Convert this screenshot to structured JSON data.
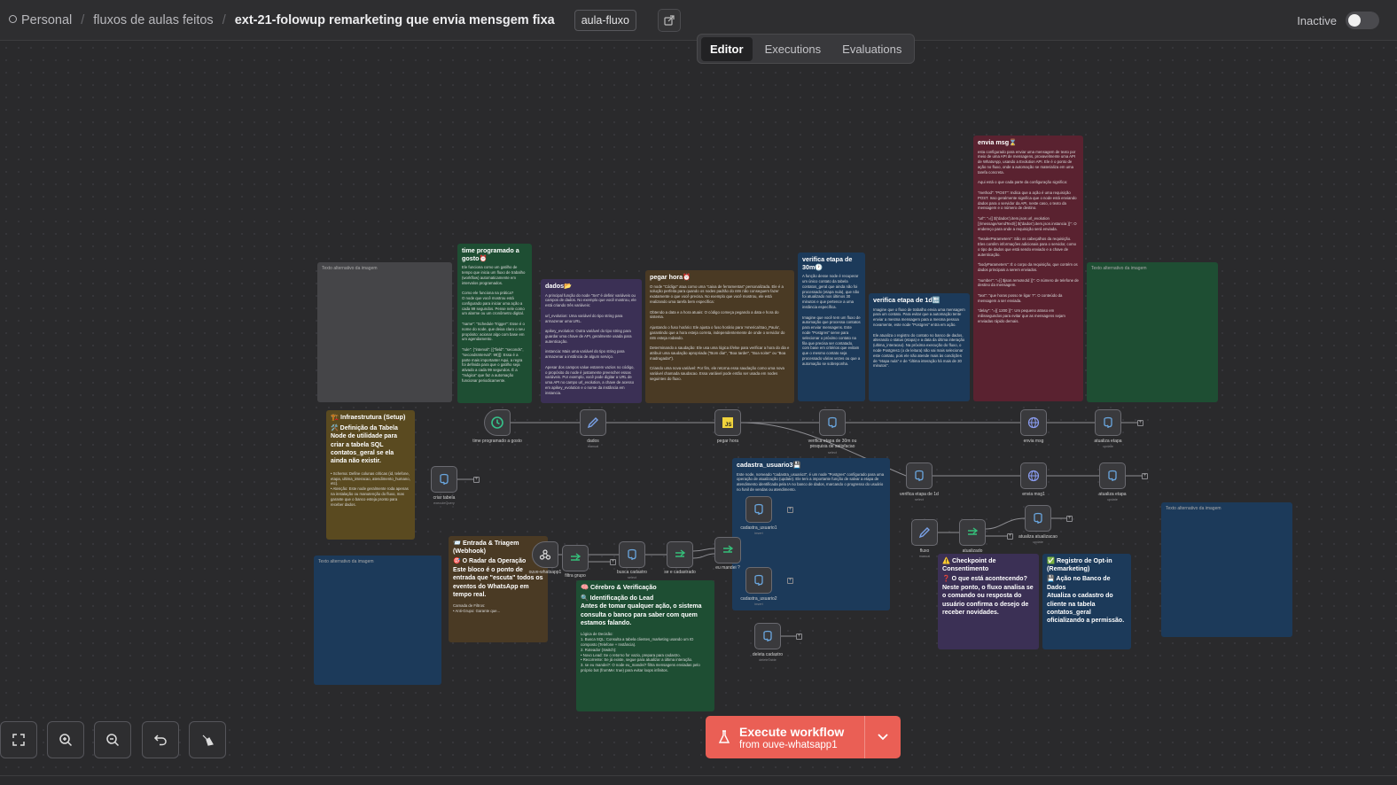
{
  "header": {
    "breadcrumb": [
      "Personal",
      "fluxos de aulas feitos",
      "ext-21-folowup remarketing que envia mensgem fixa"
    ],
    "tag": "aula-fluxo",
    "status_label": "Inactive"
  },
  "tabs": [
    "Editor",
    "Executions",
    "Evaluations"
  ],
  "notes": {
    "img_alt": "Texto alternativo da imagem",
    "trigger": {
      "title": "time programado a gosto⏰",
      "body": "Ele funciona como um gatilho de tempo que inicia um fluxo de trabalho (workflow) automaticamente em intervalos programados.\n\nComo ele funciona na prática?\nO node que você mostrou está configurado para iniciar uma ação a cada 99 segundos. Pense nele como um alarme ou um cronômetro digital.\n\n\"name\": \"Schedule Trigger\": Esse é o nome do node, que deixa claro o seu propósito: acionar algo com base em um agendamento.\n\n\"rule\": {\"interval\": [{\"field\": \"seconds\", \"secondsInterval\": 99}]}: Essa é a parte mais importante! Aqui, a regra foi definida para que o gatilho seja ativado a cada 99 segundos. É a \"mágica\" que faz a automação funcionar periodicamente."
    },
    "dados": {
      "title": "dados📂",
      "body": "A principal função do node \"Set\" é definir variáveis ou campos de dados. No exemplo que você mostrou, ele está criando três variáveis:\n\nurl_evolution: Uma variável do tipo string para armazenar uma URL.\n\napikey_evolution: Outra variável do tipo string para guardar uma chave de API, geralmente usada para autenticação.\n\ninstancia: Mais uma variável do tipo string para armazenar a instância de algum serviço.\n\nApesar dos campos value estarem vazios no código, o propósito do node é justamente preencher essas variáveis. Por exemplo, você pode digitar a URL de uma API no campo url_evolution, a chave de acesso em apikey_evolution e o nome da instância em instancia."
    },
    "pegar_hora": {
      "title": "pegar hora⏰",
      "body": "O node \"Código\" atua como uma \"caixa de ferramentas\" personalizada. Ele é a solução perfeita para quando os nodes padrão do n8n não conseguem fazer exatamente o que você precisa. No exemplo que você mostrou, ele está realizando uma tarefa bem específica:\n\nObtendo a data e a hora atuais: O código começa pegando a data e hora do sistema.\n\nAjustando o fuso horário: Ele ajusta o fuso horário para 'America/Sao_Paulo', garantindo que a hora esteja correta, independentemente de onde o servidor do n8n esteja rodando.\n\nDeterminando a saudação: Ele usa uma lógica if/else para verificar a hora do dia e atribuir uma saudação apropriada (\"Bom dia!\", \"Boa tarde!\", \"Boa noite!\" ou \"Boa madrugada!\").\n\nCriando uma nova variável: Por fim, ele retorna essa saudação como uma nova variável chamada saudacao. Essa variável pode então ser usada em nodes seguintes do fluxo."
    },
    "verifica_30m": {
      "title": "verifica etapa de 30m🕐",
      "body": "A função desse node é recuperar um único contato da tabela contatos_geral que ainda não foi processado (etapa nula), que não foi atualizado nos últimos 30 minutos e que pertence a uma instância específica.\n\nImagine que você tem um fluxo de automação que processa contatos para enviar mensagens. Este node \"Postgres\" serve para selecionar o próximo contato na fila que precisa ser contatado, com base em critérios que evitam que o mesmo contato seja processado várias vezes ou que a automação se sobreponha."
    },
    "verifica_1d": {
      "title": "verifica etapa de 1d🔚",
      "body": "Imagine que o fluxo de trabalho envia uma mensagem para um contato. Para evitar que a automação tente enviar a mesma mensagem para a mesma pessoa novamente, este node \"Postgres\" entra em ação.\n\nEle atualiza o registro do contato no banco de dados, alterando o status (etapa) e a data da última interação (ultima_interacao). Na próxima execução do fluxo, o node Postgres1 (o de leitura) não vai mais selecionar este contato, pois ele não atende mais às condições de \"etapa nula\" e de \"última interação há mais de 30 minutos\"."
    },
    "envia_msg": {
      "title": "envia msg⌛",
      "body": "esta configurado para enviar uma mensagem de texto por meio de uma API de mensagens, provavelmente uma API de WhatsApp, usando a Evolution API. Ele é o ponto de ação no fluxo, onde a automação se materializa em uma tarefa concreta.\n\nAqui está o que cada parte da configuração significa:\n\n\"method\": \"POST\": Indica que a ação é uma requisição POST. Isso geralmente significa que o node está enviando dados para o servidor da API, neste caso, o texto da mensagem e o número de destino.\n\n\"url\": \"={{ $('dados').item.json.url_evolution }}/message/sendText/{{ $('dados').item.json.instancia }}\": O endereço para onde a requisição será enviada.\n\n\"headerParameters\": São os cabeçalhos da requisição. Eles contêm informações adicionais para o servidor, como o tipo de dados que está sendo enviado e a chave de autenticação.\n\n\"bodyParameters\": É o corpo da requisição, que contém os dados principais a serem enviados.\n\n\"number\": \"={{ $json.remoteJid }}\": O número de telefone de destino da mensagem.\n\n\"text\": \"que horas posso te ligar ?\": O conteúdo da mensagem a ser enviada.\n\n\"delay\": \"={{ 1200 }}\": Um pequeno atraso em milissegundos para evitar que as mensagens sejam enviadas rápido demais."
    },
    "infra": {
      "title": "🏗️ Infraestrutura (Setup)",
      "lead": "🛠️ Definição da Tabela\nNode de utilidade para criar a tabela SQL contatos_geral se ela ainda não existir.",
      "body": "• Schema: Define colunas críticas (id, telefone, etapa, ultima_interacao, atendimento_humano, etc).\n• Atenção: Este node geralmente roda apenas na instalação ou manutenção do fluxo, mas garante que o banco esteja pronto para receber dados."
    },
    "entrada": {
      "title": "📨 Entrada & Triagem (Webhook)",
      "lead": "🎯 O Radar da Operação\nEste bloco é o ponto de entrada que \"escuta\" todos os eventos do WhatsApp em tempo real.",
      "body": "Camada de Filtros:\n• Anti-Grupo: Garante que..."
    },
    "cerebro": {
      "title": "🧠 Cérebro & Verificação",
      "lead": "🔍 Identificação do Lead\nAntes de tomar qualquer ação, o sistema consulta o banco para saber com quem estamos falando.",
      "body": "Lógica de Decisão:\n1. Busca SQL: Consulta a tabela clientes_marketing usando um ID composto (Telefone + Instância).\n2. Roteador (Switch):\n• Novo Lead: Se o retorno for vazio, prepara para cadastro.\n• Recorrente: Se já existe, segue para atualizar a última interação.\n3. se eu mandei?: O node eu_mandei? filtra mensagens enviadas pelo próprio bot (fromMe: true) para evitar loops infinitos."
    },
    "cadastra": {
      "title": "cadastra_usuario3💾",
      "body": "Este node, nomeado \"cadastra_usuario3\", é um node \"Postgres\" configurado para uma operação de atualização (update). Ele tem a importante função de salvar a etapa de atendimento identificada pela IA no banco de dados, marcando o progresso do usuário no funil de vendas ou atendimento."
    },
    "checkpoint": {
      "title": "⚠️ Checkpoint de Consentimento",
      "lead": "❓ O que está acontecendo?\nNeste ponto, o fluxo analisa se o comando ou resposta do usuário confirma o desejo de receber novidades."
    },
    "optin": {
      "title": "✅ Registro de Opt-in (Remarketing)",
      "lead": "💾 Ação no Banco de Dados\nAtualiza o cadastro do cliente na tabela contatos_geral oficializando a permissão."
    }
  },
  "nodes": {
    "time_programado": "time programado a gosto",
    "dados": "dados",
    "dados_sub": "manual",
    "pegar_hora": "pegar hora",
    "verifica_30m": "verifica etapa de 30m ou pesquisa de satisfacao",
    "verifica_30m_sub": "select",
    "envia_msg": "envia msg",
    "atualiza_etapa": "atualiza etapa",
    "atualiza_etapa_sub": "update",
    "criar_tabela": "criar tabela",
    "criar_tabela_sub": "executeQuery",
    "verifica_1d": "verifica etapa de 1d",
    "verifica_1d_sub": "select",
    "envia_msg1": "envia msg1",
    "atualiza_etapa1": "atualiza etapa",
    "atualiza_etapa1_sub": "update",
    "cadastra_usuario1": "cadastra_usuario1",
    "cadastra_usuario1_sub": "insert",
    "cadastra_usuario2": "cadastra_usuario2",
    "cadastra_usuario2_sub": "insert",
    "fluxo": "fluxo",
    "fluxo_sub": "manual",
    "atualizado": "atualizado",
    "atualiza_atualizacao": "atualiza atualizacao",
    "atualiza_atualizacao_sub": "update",
    "ouve_whatsapp": "ouve-whatsapp1",
    "filtra_grupo": "filtra grupo",
    "busca_cadastro": "busca cadastro",
    "busca_cadastro_sub": "select",
    "se_cadastrado": "se e cadastrado",
    "eu_mandei": "eu mandei ?",
    "deleta_cadastro": "deleta cadastro",
    "deleta_cadastro_sub": "deleteTable"
  },
  "execute": {
    "title": "Execute workflow",
    "subtitle": "from ouve-whatsapp1"
  },
  "colors": {
    "accent": "#ea5f55",
    "bg": "#2a2a2c",
    "header": "#2e2e30"
  }
}
